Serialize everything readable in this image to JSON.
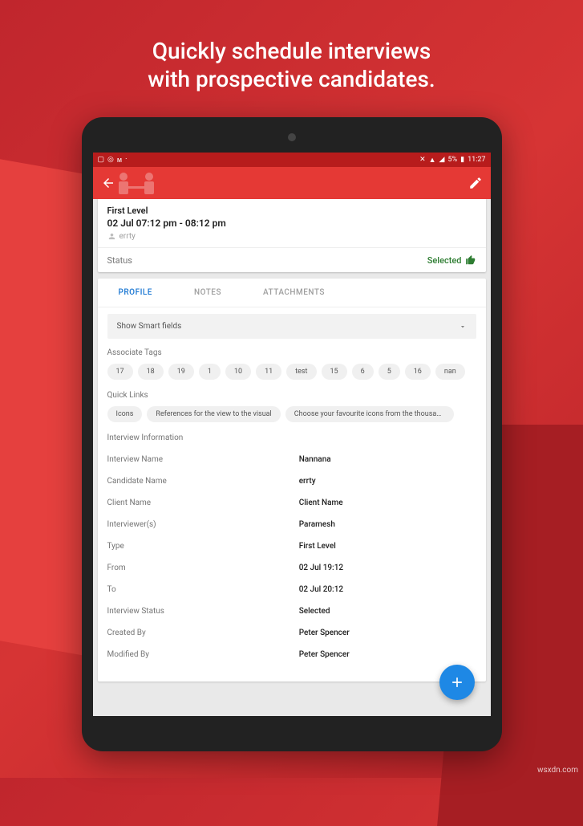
{
  "marketing": {
    "line1": "Quickly schedule interviews",
    "line2": "with prospective candidates."
  },
  "statusbar": {
    "battery_text": "5%",
    "time": "11:27"
  },
  "summary": {
    "level": "First Level",
    "time_range": "02 Jul 07:12 pm - 08:12 pm",
    "candidate": "errty"
  },
  "status": {
    "label": "Status",
    "value": "Selected"
  },
  "tabs": {
    "profile": "PROFILE",
    "notes": "NOTES",
    "attachments": "ATTACHMENTS"
  },
  "smart_fields_label": "Show Smart fields",
  "associate_tags_label": "Associate Tags",
  "tags": [
    "17",
    "18",
    "19",
    "1",
    "10",
    "11",
    "test",
    "15",
    "6",
    "5",
    "16",
    "nan"
  ],
  "quick_links_label": "Quick Links",
  "quick_links": [
    "Icons",
    "References for the view to the visual",
    "Choose your favourite icons from the thousand..."
  ],
  "section_title": "Interview Information",
  "info": [
    {
      "k": "Interview Name",
      "v": "Nannana"
    },
    {
      "k": "Candidate Name",
      "v": "errty"
    },
    {
      "k": "Client Name",
      "v": "Client Name"
    },
    {
      "k": "Interviewer(s)",
      "v": "Paramesh"
    },
    {
      "k": "Type",
      "v": "First Level"
    },
    {
      "k": "From",
      "v": "02 Jul 19:12"
    },
    {
      "k": "To",
      "v": "02 Jul 20:12"
    },
    {
      "k": "Interview Status",
      "v": "Selected"
    },
    {
      "k": "Created By",
      "v": "Peter Spencer"
    },
    {
      "k": "Modified By",
      "v": "Peter Spencer"
    }
  ],
  "watermark": "wsxdn.com"
}
